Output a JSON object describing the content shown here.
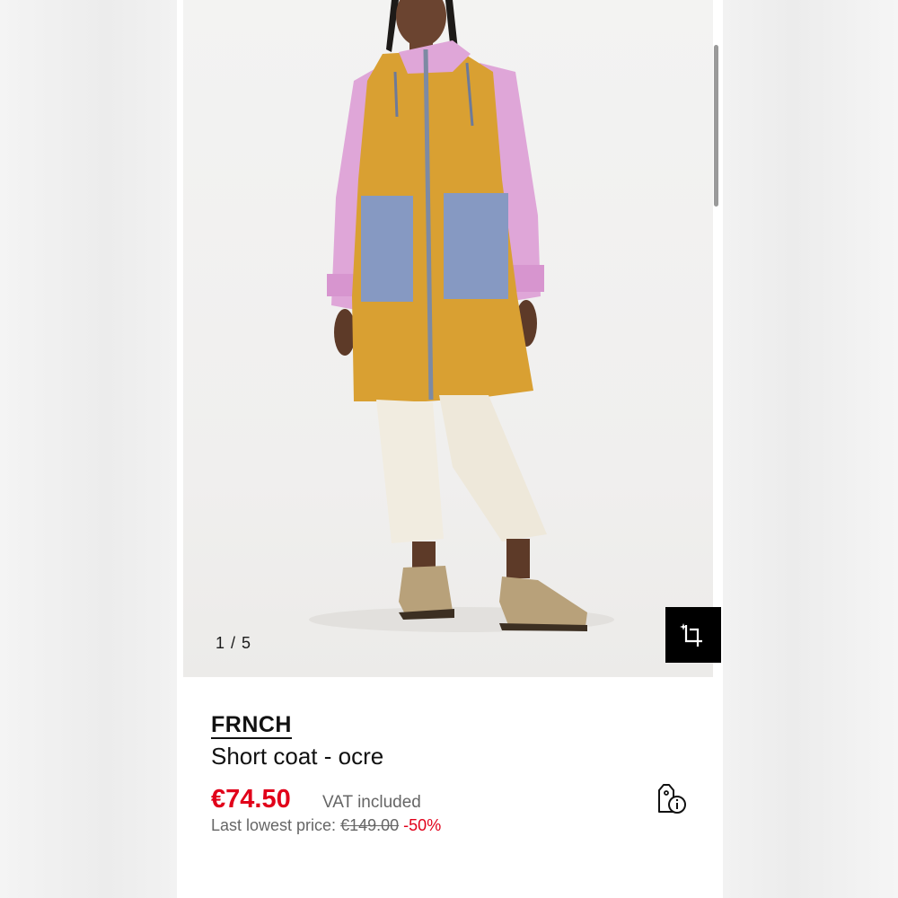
{
  "gallery": {
    "counter": "1 / 5",
    "save_look_icon": "crop-sparkle-icon"
  },
  "product": {
    "brand": "FRNCH",
    "name": "Short coat - ocre",
    "price": "€74.50",
    "vat": "VAT included",
    "lowest_label": "Last lowest price:",
    "lowest_price": "€149.00",
    "discount": "-50%",
    "price_info_icon": "price-tag-info-icon"
  },
  "colors": {
    "price_red": "#e1001a",
    "coat_ochre": "#d9a032",
    "sleeve_pink": "#dda0d6",
    "pocket_blue": "#8598c0"
  }
}
